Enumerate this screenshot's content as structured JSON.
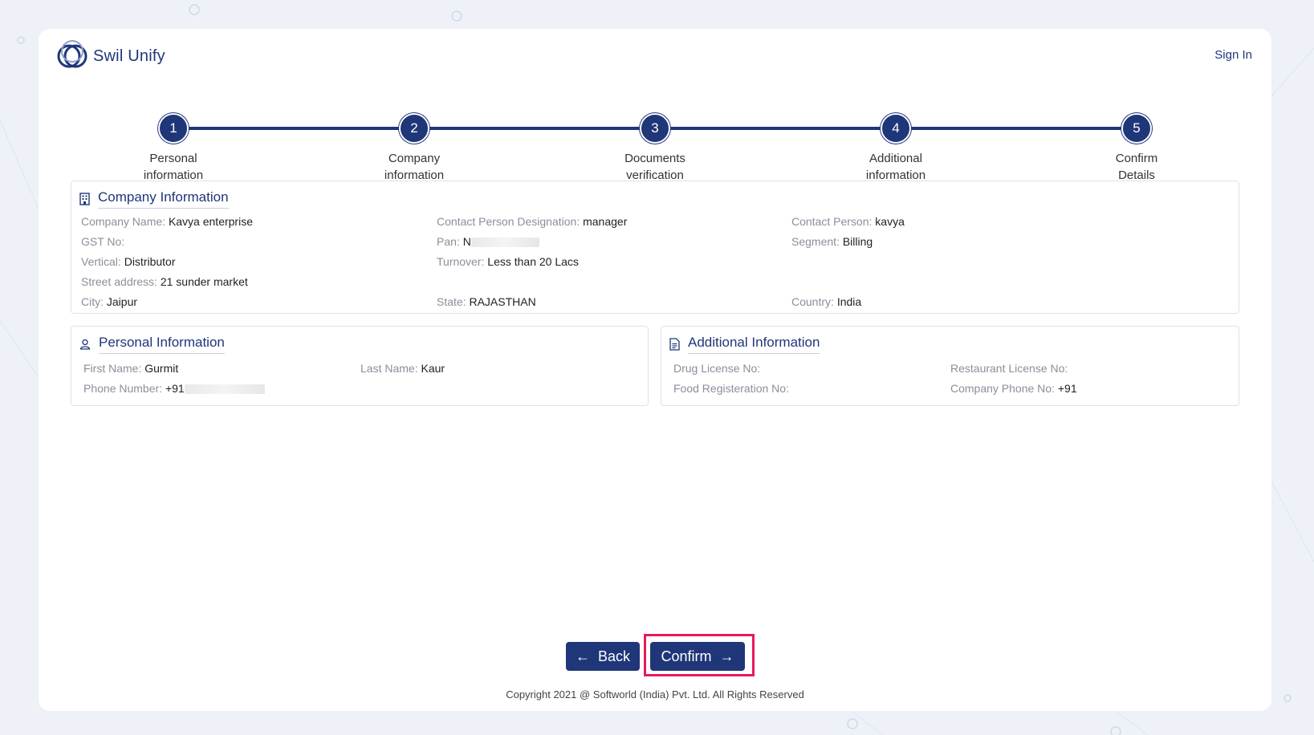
{
  "brand": {
    "name": "Swil Unify"
  },
  "header": {
    "signin_label": "Sign In"
  },
  "steps": [
    {
      "number": "1",
      "line1": "Personal",
      "line2": "information"
    },
    {
      "number": "2",
      "line1": "Company",
      "line2": "information"
    },
    {
      "number": "3",
      "line1": "Documents",
      "line2": "verification"
    },
    {
      "number": "4",
      "line1": "Additional",
      "line2": "information"
    },
    {
      "number": "5",
      "line1": "Confirm",
      "line2": "Details"
    }
  ],
  "company": {
    "title": "Company Information",
    "company_name": {
      "label": "Company Name:",
      "value": "Kavya enterprise"
    },
    "designation": {
      "label": "Contact Person Designation:",
      "value": "manager"
    },
    "contact_person": {
      "label": "Contact Person:",
      "value": "kavya"
    },
    "gst": {
      "label": "GST No:",
      "value": ""
    },
    "pan": {
      "label": "Pan:",
      "value": "N"
    },
    "segment": {
      "label": "Segment:",
      "value": "Billing"
    },
    "vertical": {
      "label": "Vertical:",
      "value": "Distributor"
    },
    "turnover": {
      "label": "Turnover:",
      "value": "Less than 20 Lacs"
    },
    "street": {
      "label": "Street address:",
      "value": "21 sunder market"
    },
    "city": {
      "label": "City:",
      "value": "Jaipur"
    },
    "state": {
      "label": "State:",
      "value": "RAJASTHAN"
    },
    "country": {
      "label": "Country:",
      "value": "India"
    }
  },
  "personal": {
    "title": "Personal Information",
    "first_name": {
      "label": "First Name:",
      "value": "Gurmit"
    },
    "last_name": {
      "label": "Last Name:",
      "value": "Kaur"
    },
    "phone": {
      "label": "Phone Number:",
      "value": "+91"
    }
  },
  "additional": {
    "title": "Additional Information",
    "drug_license": {
      "label": "Drug License No:",
      "value": ""
    },
    "restaurant_license": {
      "label": "Restaurant License No:",
      "value": ""
    },
    "food_reg": {
      "label": "Food Registeration No:",
      "value": ""
    },
    "company_phone": {
      "label": "Company Phone No:",
      "value": "+91"
    }
  },
  "actions": {
    "back_label": "Back",
    "confirm_label": "Confirm"
  },
  "footer": {
    "copyright": "Copyright 2021 @ Softworld (India) Pvt. Ltd. All Rights Reserved"
  },
  "colors": {
    "primary": "#1f3679",
    "highlight": "#e6195d",
    "background": "#eef1f8"
  }
}
